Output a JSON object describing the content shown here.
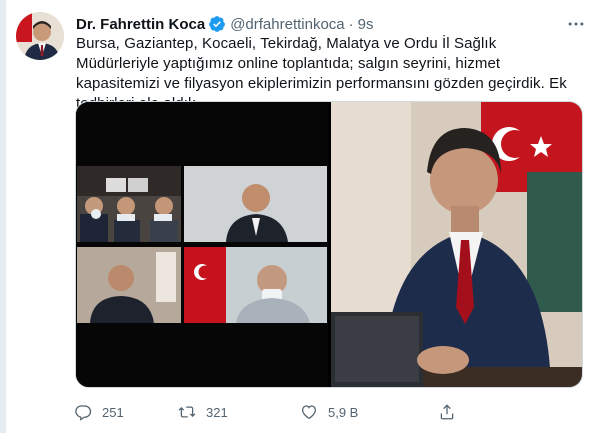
{
  "tweet": {
    "display_name": "Dr. Fahrettin Koca",
    "handle": "@drfahrettinkoca",
    "separator": "·",
    "timestamp": "9s",
    "text": "Bursa, Gaziantep, Kocaeli, Tekirdağ, Malatya ve Ordu İl Sağlık Müdürleriyle yaptığımız online toplantıda; salgın seyrini, hizmet kapasitemizi ve filyasyon ekiplerimizin performansını gözden geçirdik. Ek tedbirleri ele aldık.",
    "verified": true
  },
  "actions": {
    "replies": "251",
    "retweets": "321",
    "likes": "5,9 B"
  },
  "icons": [
    "more-icon",
    "verified-icon",
    "reply-icon",
    "retweet-icon",
    "like-icon",
    "share-icon"
  ],
  "colors": {
    "text": "#0f1419",
    "muted": "#536471",
    "verified": "#1d9bf0",
    "border": "#cfd9de"
  }
}
